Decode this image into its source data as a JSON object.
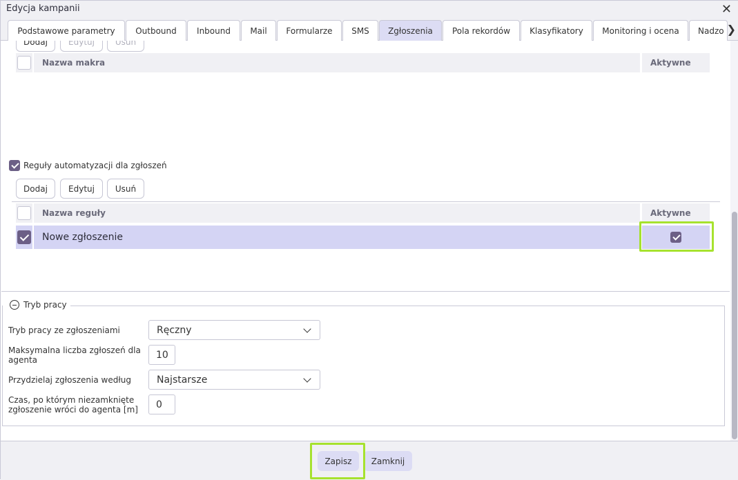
{
  "window": {
    "title": "Edycja kampanii"
  },
  "tabs": [
    {
      "label": "Podstawowe parametry",
      "active": false
    },
    {
      "label": "Outbound",
      "active": false
    },
    {
      "label": "Inbound",
      "active": false
    },
    {
      "label": "Mail",
      "active": false
    },
    {
      "label": "Formularze",
      "active": false
    },
    {
      "label": "SMS",
      "active": false
    },
    {
      "label": "Zgłoszenia",
      "active": true
    },
    {
      "label": "Pola rekordów",
      "active": false
    },
    {
      "label": "Klasyfikatory",
      "active": false
    },
    {
      "label": "Monitoring i ocena",
      "active": false
    },
    {
      "label": "Nadzo",
      "active": false
    }
  ],
  "macros": {
    "buttons": {
      "add": "Dodaj",
      "edit": "Edytuj",
      "delete": "Usuń"
    },
    "columns": {
      "name": "Nazwa makra",
      "active": "Aktywne"
    }
  },
  "rules": {
    "checkbox_label": "Reguły automatyzacji dla zgłoszeń",
    "checked": true,
    "buttons": {
      "add": "Dodaj",
      "edit": "Edytuj",
      "delete": "Usuń"
    },
    "columns": {
      "name": "Nazwa reguły",
      "active": "Aktywne"
    },
    "rows": [
      {
        "name": "Nowe zgłoszenie",
        "selected": true,
        "active": true
      }
    ]
  },
  "work_mode": {
    "legend": "Tryb pracy",
    "fields": {
      "mode_label": "Tryb pracy ze zgłoszeniami",
      "mode_value": "Ręczny",
      "max_label": "Maksymalna liczba zgłoszeń dla agenta",
      "max_value": "10",
      "assign_label": "Przydzielaj zgłoszenia według",
      "assign_value": "Najstarsze",
      "time_label": "Czas, po którym niezamknięte zgłoszenie wróci do agenta [m]",
      "time_value": "0"
    }
  },
  "footer": {
    "save": "Zapisz",
    "close": "Zamknij"
  },
  "colors": {
    "highlight": "#a6e22e",
    "selected_row": "#d4d4f4",
    "checkbox_checked": "#6c5f86"
  }
}
